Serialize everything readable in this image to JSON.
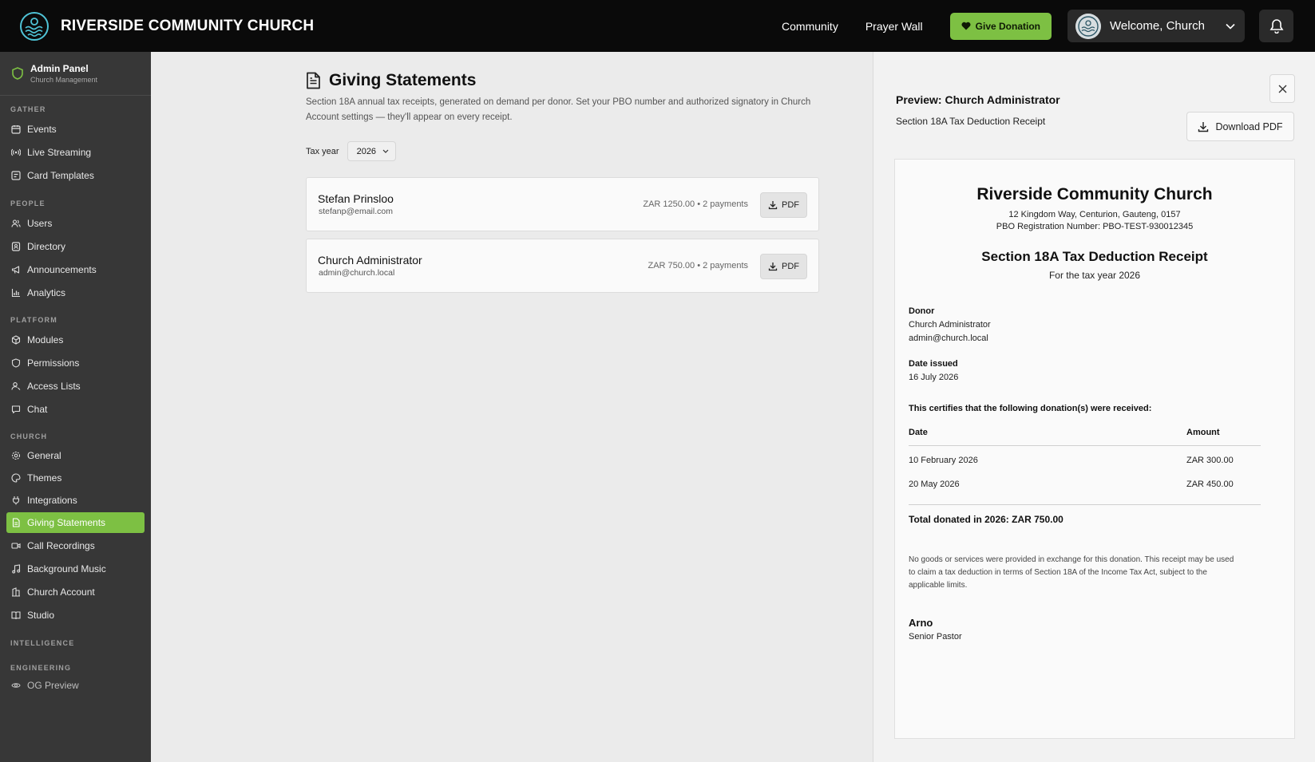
{
  "header": {
    "title": "RIVERSIDE COMMUNITY CHURCH",
    "nav": [
      "Community",
      "Prayer Wall"
    ],
    "donate_label": "Give Donation",
    "welcome": "Welcome, Church"
  },
  "sidebar": {
    "title": "Admin Panel",
    "subtitle": "Church Management",
    "sections": {
      "gather": "GATHER",
      "people": "PEOPLE",
      "platform": "PLATFORM",
      "church": "CHURCH",
      "intelligence": "INTELLIGENCE",
      "engineering": "ENGINEERING"
    },
    "items": {
      "events": "Events",
      "live_streaming": "Live Streaming",
      "card_templates": "Card Templates",
      "users": "Users",
      "directory": "Directory",
      "announcements": "Announcements",
      "analytics": "Analytics",
      "modules": "Modules",
      "permissions": "Permissions",
      "access_lists": "Access Lists",
      "chat": "Chat",
      "general": "General",
      "themes": "Themes",
      "integrations": "Integrations",
      "giving_statements": "Giving Statements",
      "call_recordings": "Call Recordings",
      "background_music": "Background Music",
      "church_account": "Church Account",
      "studio": "Studio",
      "og_preview": "OG Preview"
    },
    "active_color": "#7dc043"
  },
  "main": {
    "title": "Giving Statements",
    "description": "Section 18A annual tax receipts, generated on demand per donor. Set your PBO number and authorized signatory in Church Account settings — they'll appear on every receipt.",
    "tax_year_label": "Tax year",
    "tax_year_value": "2026",
    "pdf_label": "PDF",
    "donors": [
      {
        "name": "Stefan Prinsloo",
        "email": "stefanp@email.com",
        "summary": "ZAR 1250.00 • 2 payments"
      },
      {
        "name": "Church Administrator",
        "email": "admin@church.local",
        "summary": "ZAR 750.00 • 2 payments"
      }
    ]
  },
  "preview": {
    "title": "Preview: Church Administrator",
    "subtitle": "Section 18A Tax Deduction Receipt",
    "download_label": "Download PDF",
    "receipt": {
      "church": "Riverside Community Church",
      "address": "12 Kingdom Way, Centurion, Gauteng, 0157",
      "pbo": "PBO Registration Number: PBO-TEST-930012345",
      "heading": "Section 18A Tax Deduction Receipt",
      "for_year": "For the tax year 2026",
      "donor_label": "Donor",
      "donor_name": "Church Administrator",
      "donor_email": "admin@church.local",
      "date_issued_label": "Date issued",
      "date_issued": "16 July 2026",
      "certify": "This certifies that the following donation(s) were received:",
      "col_date": "Date",
      "col_amount": "Amount",
      "rows": [
        {
          "date": "10 February 2026",
          "amount": "ZAR 300.00"
        },
        {
          "date": "20 May 2026",
          "amount": "ZAR 450.00"
        }
      ],
      "total": "Total donated in 2026: ZAR 750.00",
      "note": "No goods or services were provided in exchange for this donation. This receipt may be used to claim a tax deduction in terms of Section 18A of the Income Tax Act, subject to the applicable limits.",
      "signatory": "Arno",
      "signatory_title": "Senior Pastor"
    }
  }
}
